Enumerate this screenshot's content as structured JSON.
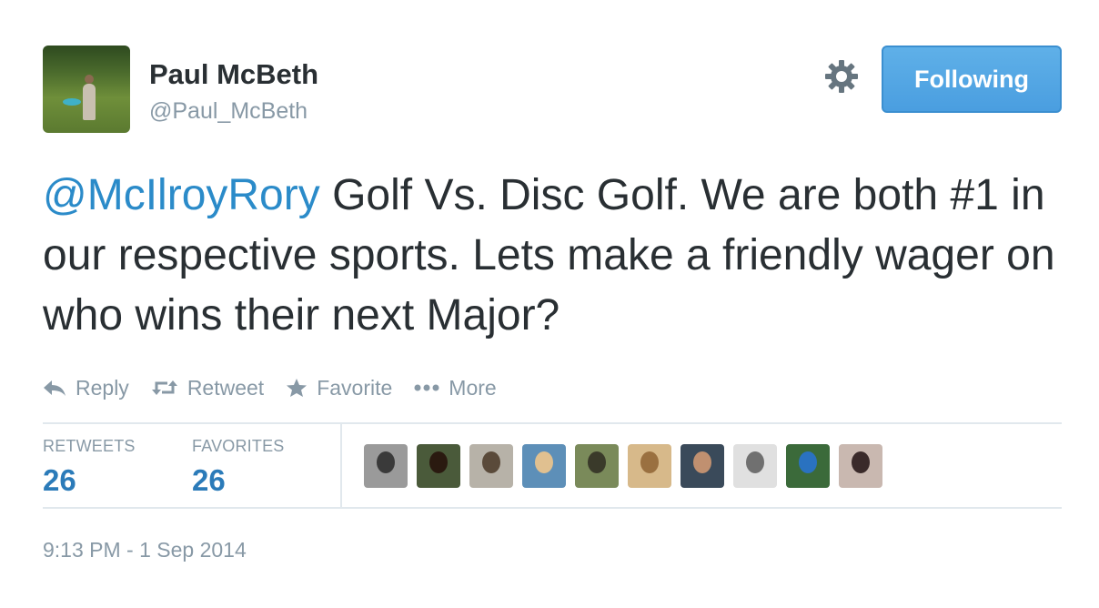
{
  "author": {
    "name": "Paul McBeth",
    "handle": "@Paul_McBeth"
  },
  "follow_button": {
    "label": "Following",
    "color": "#55acee"
  },
  "tweet": {
    "mention": "@McIlroyRory",
    "text": " Golf Vs. Disc Golf. We are both #1 in our respective sports. Lets make a friendly wager on who wins their next Major?"
  },
  "actions": [
    {
      "label": "Reply",
      "icon": "reply-icon"
    },
    {
      "label": "Retweet",
      "icon": "retweet-icon"
    },
    {
      "label": "Favorite",
      "icon": "star-icon"
    },
    {
      "label": "More",
      "icon": "more-dots-icon"
    }
  ],
  "stats": {
    "retweets_label": "RETWEETS",
    "retweets_value": "26",
    "favorites_label": "FAVORITES",
    "favorites_value": "26"
  },
  "favoriter_avatars": [
    {
      "bg": "#9a9a9a",
      "fg": "#3a3a3a"
    },
    {
      "bg": "#4a5a3a",
      "fg": "#2a1a10"
    },
    {
      "bg": "#b7b2a8",
      "fg": "#5a4a3a"
    },
    {
      "bg": "#5d8fb8",
      "fg": "#e0c090"
    },
    {
      "bg": "#7a8a5a",
      "fg": "#3a3a2a"
    },
    {
      "bg": "#d7b98a",
      "fg": "#9a7040"
    },
    {
      "bg": "#3a4a5a",
      "fg": "#c09070"
    },
    {
      "bg": "#e0e0e0",
      "fg": "#707070"
    },
    {
      "bg": "#3b6a3a",
      "fg": "#2a72c0"
    },
    {
      "bg": "#c9b8b0",
      "fg": "#3a2a2a"
    }
  ],
  "timestamp": "9:13 PM - 1 Sep 2014",
  "colors": {
    "mention": "#2b8bc9",
    "muted": "#8899a6",
    "stat_value": "#2b7bb9"
  }
}
